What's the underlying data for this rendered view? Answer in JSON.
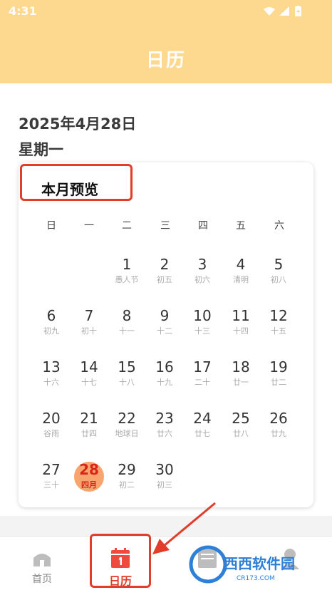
{
  "status_bar": {
    "time": "4:31"
  },
  "header": {
    "title": "日历",
    "background_color": "#fdd88f"
  },
  "date": {
    "full": "2025年4月28日",
    "weekday": "星期一"
  },
  "preview": {
    "title": "本月预览",
    "weekdays": [
      "日",
      "一",
      "二",
      "三",
      "四",
      "五",
      "六"
    ],
    "days": [
      {
        "day": "1",
        "lunar": "愚人节"
      },
      {
        "day": "2",
        "lunar": "初五"
      },
      {
        "day": "3",
        "lunar": "初六"
      },
      {
        "day": "4",
        "lunar": "清明"
      },
      {
        "day": "5",
        "lunar": "初八"
      },
      {
        "day": "6",
        "lunar": "初九"
      },
      {
        "day": "7",
        "lunar": "初十"
      },
      {
        "day": "8",
        "lunar": "十一"
      },
      {
        "day": "9",
        "lunar": "十二"
      },
      {
        "day": "10",
        "lunar": "十三"
      },
      {
        "day": "11",
        "lunar": "十四"
      },
      {
        "day": "12",
        "lunar": "十五"
      },
      {
        "day": "13",
        "lunar": "十六"
      },
      {
        "day": "14",
        "lunar": "十七"
      },
      {
        "day": "15",
        "lunar": "十八"
      },
      {
        "day": "16",
        "lunar": "十九"
      },
      {
        "day": "17",
        "lunar": "二十"
      },
      {
        "day": "18",
        "lunar": "廿一"
      },
      {
        "day": "19",
        "lunar": "廿二"
      },
      {
        "day": "20",
        "lunar": "谷雨"
      },
      {
        "day": "21",
        "lunar": "廿四"
      },
      {
        "day": "22",
        "lunar": "地球日"
      },
      {
        "day": "23",
        "lunar": "廿六"
      },
      {
        "day": "24",
        "lunar": "廿七"
      },
      {
        "day": "25",
        "lunar": "廿八"
      },
      {
        "day": "26",
        "lunar": "廿九"
      },
      {
        "day": "27",
        "lunar": "三十"
      },
      {
        "day": "28",
        "lunar": "四月"
      },
      {
        "day": "29",
        "lunar": "初二"
      },
      {
        "day": "30",
        "lunar": "初三"
      }
    ],
    "today": "28",
    "today_color": "#f7a46e"
  },
  "bottom_nav": {
    "items": [
      {
        "label": "首页",
        "icon": "home-icon"
      },
      {
        "label": "日历",
        "icon": "calendar-icon"
      },
      {
        "label": "",
        "icon": "list-icon"
      },
      {
        "label": "",
        "icon": "profile-icon"
      }
    ],
    "active_color": "#e23c2a"
  },
  "watermark": {
    "text": "西西软件园",
    "sub": "CR173.COM"
  }
}
